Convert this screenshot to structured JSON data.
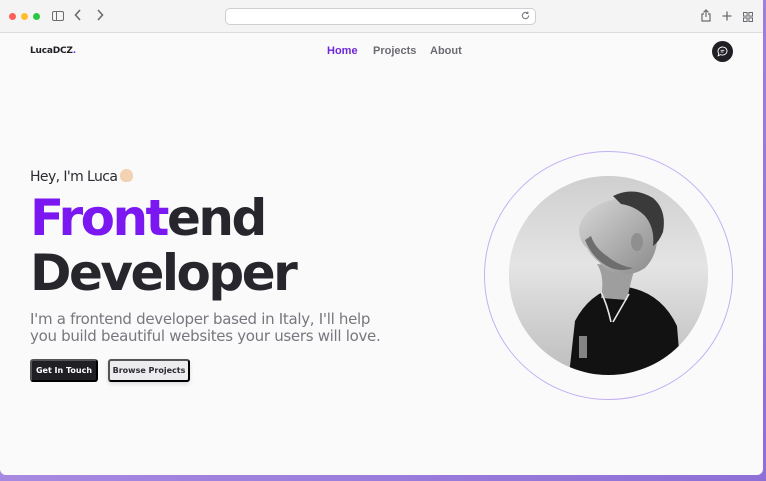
{
  "browser": {
    "address": "",
    "icons": [
      "sidebar-icon",
      "back-icon",
      "forward-icon",
      "reload-icon",
      "share-icon",
      "new-tab-icon",
      "tabs-overview-icon"
    ]
  },
  "site": {
    "logo": "LucaDCZ",
    "logo_dot": ".",
    "nav": [
      {
        "label": "Home",
        "active": true
      },
      {
        "label": "Projects",
        "active": false
      },
      {
        "label": "About",
        "active": false
      }
    ],
    "chat_icon": "chat-bubble-icon"
  },
  "hero": {
    "greeting": "Hey, I'm Luca",
    "emoji": "waving-hand",
    "title_highlight": "Front",
    "title_rest": "end",
    "title_line2": "Developer",
    "description": "I'm a frontend developer based in Italy, I'll help you build beautiful websites your users will love.",
    "primary_button": "Get In Touch",
    "secondary_button": "Browse Projects",
    "portrait": "black-and-white-portrait"
  },
  "colors": {
    "accent": "#7b17f0",
    "nav_active": "#6d28d9",
    "dark": "#1f1f24",
    "ring": "#c3b0f3"
  }
}
